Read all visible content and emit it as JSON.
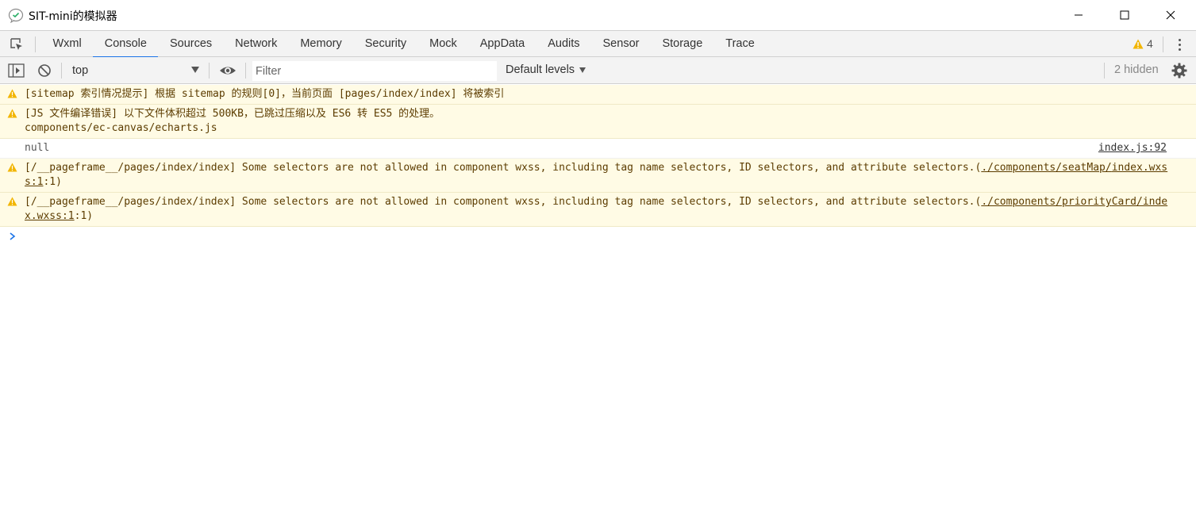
{
  "window": {
    "title": "SIT-mini的模拟器",
    "app_icon": "wechat-devtools-icon",
    "controls": [
      "minimize-icon",
      "maximize-icon",
      "close-icon"
    ]
  },
  "tabs": {
    "items": [
      {
        "label": "Wxml"
      },
      {
        "label": "Console"
      },
      {
        "label": "Sources"
      },
      {
        "label": "Network"
      },
      {
        "label": "Memory"
      },
      {
        "label": "Security"
      },
      {
        "label": "Mock"
      },
      {
        "label": "AppData"
      },
      {
        "label": "Audits"
      },
      {
        "label": "Sensor"
      },
      {
        "label": "Storage"
      },
      {
        "label": "Trace"
      }
    ],
    "active": "Console",
    "warning_count": "4",
    "accent_color": "#1a73e8",
    "warning_color": "#f2b500"
  },
  "toolbar": {
    "context": "top",
    "filter_placeholder": "Filter",
    "levels_label": "Default levels",
    "hidden_label": "2 hidden"
  },
  "messages": [
    {
      "level": "warning",
      "text": "[sitemap 索引情况提示] 根据 sitemap 的规则[0]，当前页面 [pages/index/index] 将被索引"
    },
    {
      "level": "warning",
      "line1": "[JS 文件编译错误] 以下文件体积超过 500KB，已跳过压缩以及 ES6 转 ES5 的处理。",
      "line2": "components/ec-canvas/echarts.js"
    },
    {
      "level": "log",
      "text": "null",
      "source": "index.js:92"
    },
    {
      "level": "warning",
      "prefix": "[/__pageframe__/pages/index/index] Some selectors are not allowed in component wxss, including tag name selectors, ID selectors, and attribute selectors.(",
      "link_a": "./components/seatMap/",
      "link_b": "index.wxss:1",
      "suffix": ":1)"
    },
    {
      "level": "warning",
      "prefix": "[/__pageframe__/pages/index/index] Some selectors are not allowed in component wxss, including tag name selectors, ID selectors, and attribute selectors.(",
      "link_a": "./components/priority",
      "link_b": "Card/index.wxss:1",
      "suffix": ":1)"
    }
  ]
}
